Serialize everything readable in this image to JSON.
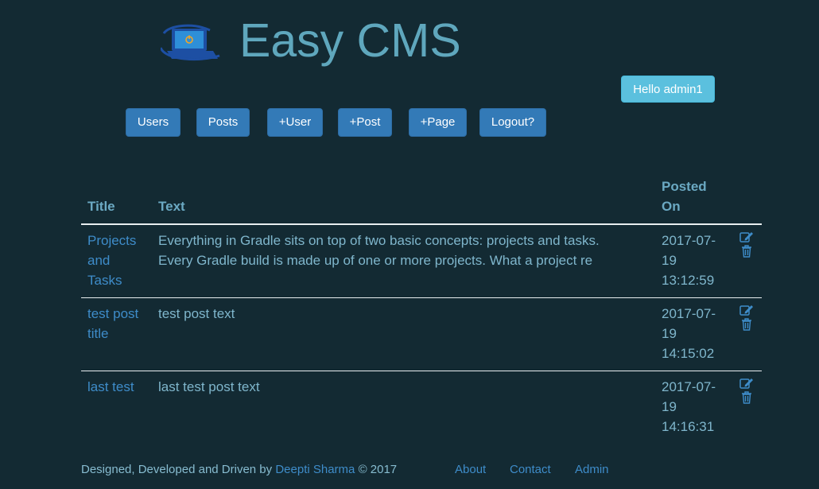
{
  "header": {
    "site_title": "Easy CMS",
    "logo_icon": "laptop-power-icon",
    "greeting": "Hello admin1"
  },
  "nav": {
    "users": "Users",
    "posts": "Posts",
    "add_user": "+User",
    "add_post": "+Post",
    "add_page": "+Page",
    "logout": "Logout?"
  },
  "table": {
    "columns": {
      "title": "Title",
      "text": "Text",
      "posted_on": "Posted On"
    },
    "rows": [
      {
        "title": "Projects and Tasks",
        "text": "Everything in Gradle sits on top of two basic concepts: projects and tasks. Every Gradle build is made up of one or more projects. What a project re",
        "posted_on": "2017-07-19 13:12:59",
        "edit_icon": "edit-icon",
        "delete_icon": "trash-icon"
      },
      {
        "title": "test post title",
        "text": "test post text",
        "posted_on": "2017-07-19 14:15:02",
        "edit_icon": "edit-icon",
        "delete_icon": "trash-icon"
      },
      {
        "title": "last test",
        "text": "last test post text",
        "posted_on": "2017-07-19 14:16:31",
        "edit_icon": "edit-icon",
        "delete_icon": "trash-icon"
      }
    ]
  },
  "footer": {
    "credit_prefix": "Designed, Developed and Driven by",
    "author": "Deepti Sharma",
    "copyright": "© 2017",
    "links": {
      "about": "About",
      "contact": "Contact",
      "admin": "Admin"
    }
  },
  "colors": {
    "background": "#132a33",
    "primary_button": "#337ab7",
    "info_button": "#5bc0de",
    "link": "#3e8cc9",
    "text": "#7fb6cc"
  }
}
